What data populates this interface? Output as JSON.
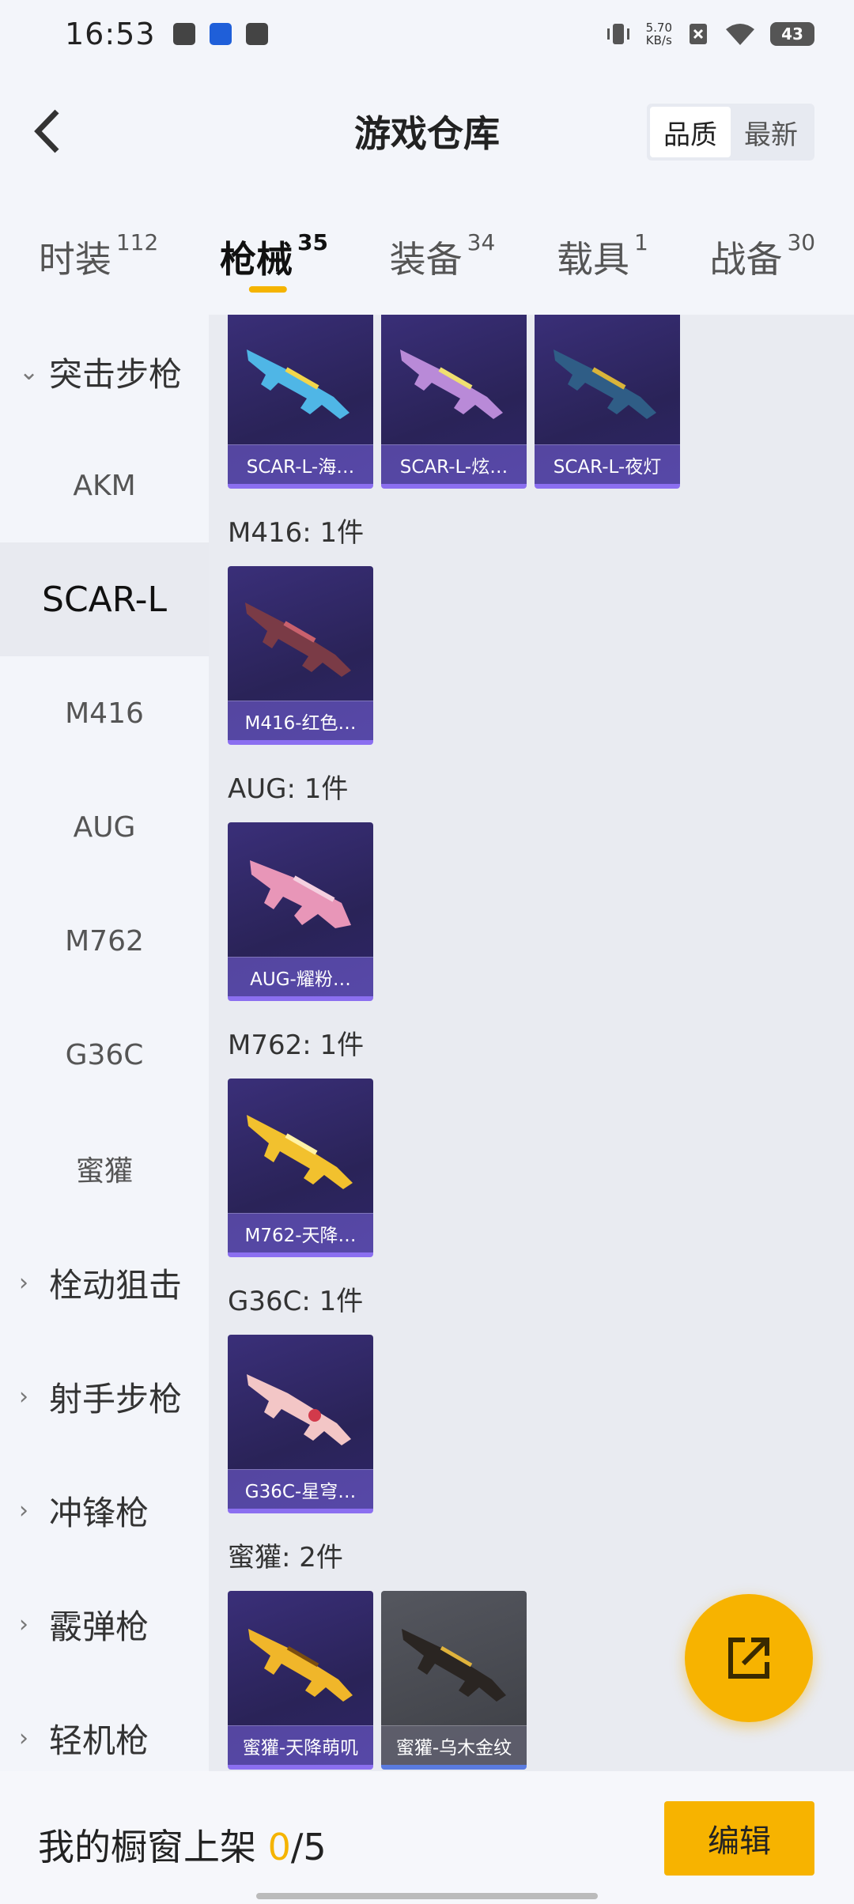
{
  "status_bar": {
    "time": "16:53",
    "net_speed_value": "5.70",
    "net_speed_unit": "KB/s",
    "battery": "43"
  },
  "header": {
    "title": "游戏仓库",
    "sort_options": [
      "品质",
      "最新"
    ],
    "sort_selected": "品质"
  },
  "tabs": [
    {
      "label": "时装",
      "count": "112"
    },
    {
      "label": "枪械",
      "count": "35",
      "active": true
    },
    {
      "label": "装备",
      "count": "34"
    },
    {
      "label": "载具",
      "count": "1"
    },
    {
      "label": "战备",
      "count": "30"
    }
  ],
  "sidebar": {
    "items": [
      {
        "label": "突击步枪",
        "type": "group",
        "expanded": true
      },
      {
        "label": "AKM",
        "type": "sub"
      },
      {
        "label": "SCAR-L",
        "type": "sub",
        "selected": true
      },
      {
        "label": "M416",
        "type": "sub"
      },
      {
        "label": "AUG",
        "type": "sub"
      },
      {
        "label": "M762",
        "type": "sub"
      },
      {
        "label": "G36C",
        "type": "sub"
      },
      {
        "label": "蜜獾",
        "type": "sub"
      },
      {
        "label": "栓动狙击",
        "type": "group"
      },
      {
        "label": "射手步枪",
        "type": "group"
      },
      {
        "label": "冲锋枪",
        "type": "group"
      },
      {
        "label": "霰弹枪",
        "type": "group"
      },
      {
        "label": "轻机枪",
        "type": "group"
      }
    ]
  },
  "content": {
    "scar_cards": [
      "SCAR-L-海…",
      "SCAR-L-炫…",
      "SCAR-L-夜灯"
    ],
    "sections": [
      {
        "label": "M416: 1件",
        "cards": [
          "M416-红色…"
        ]
      },
      {
        "label": "AUG: 1件",
        "cards": [
          "AUG-耀粉…"
        ]
      },
      {
        "label": "M762: 1件",
        "cards": [
          "M762-天降…"
        ]
      },
      {
        "label": "G36C: 1件",
        "cards": [
          "G36C-星穹…"
        ]
      },
      {
        "label": "蜜獾: 2件",
        "cards": [
          "蜜獾-天降萌叽",
          "蜜獾-乌木金纹"
        ]
      }
    ]
  },
  "bottom_bar": {
    "shelf_label": "我的橱窗上架 ",
    "shelf_current": "0",
    "shelf_total": "/5",
    "edit_label": "编辑"
  },
  "icons": {
    "back": "back-arrow-icon",
    "fab": "share-export-icon"
  },
  "colors": {
    "accent": "#f7b300",
    "card_bg": "#2a2358",
    "card_gray_bg": "#3d3f45"
  }
}
